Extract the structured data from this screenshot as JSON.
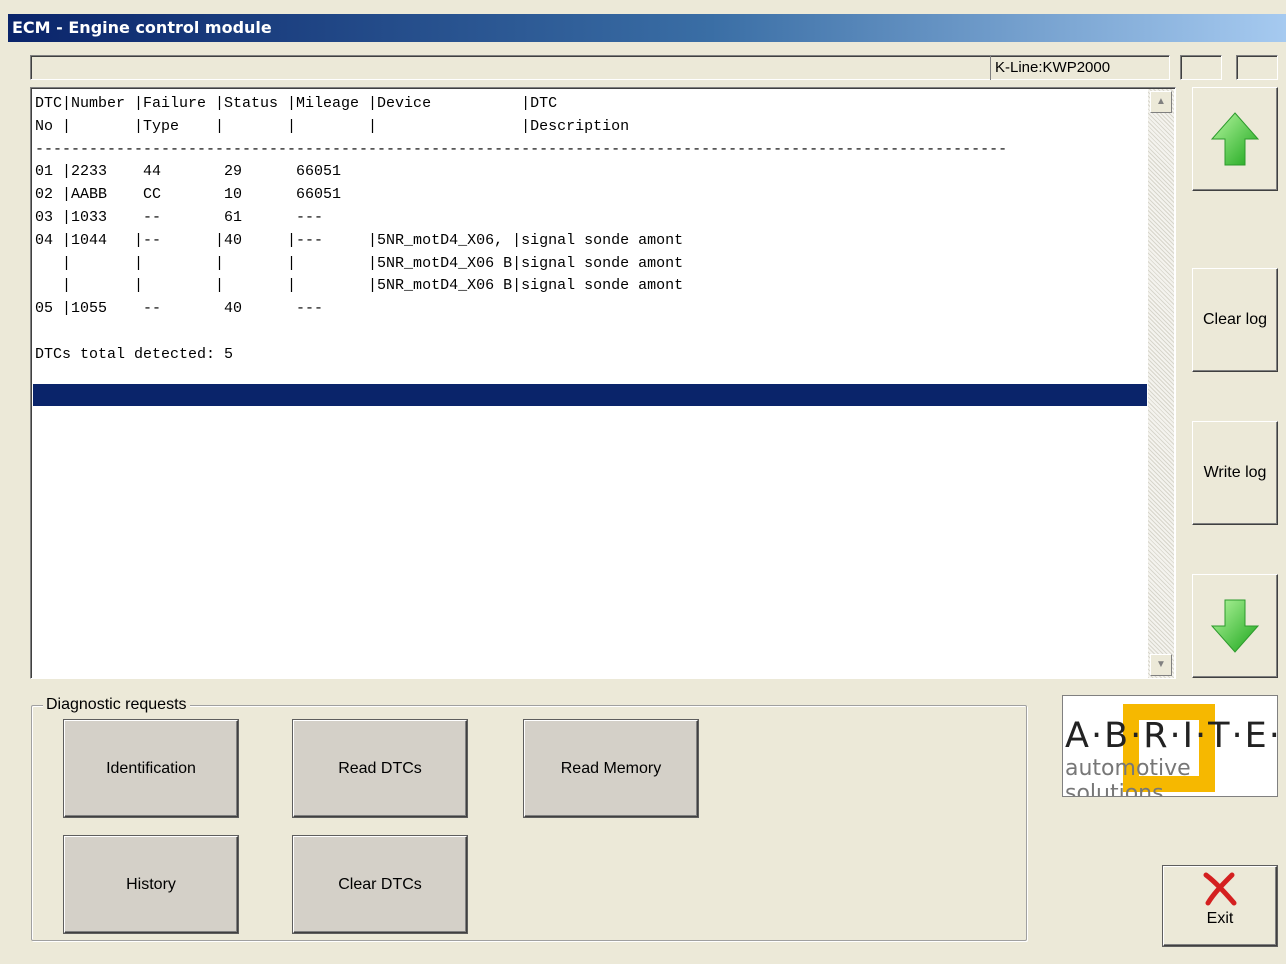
{
  "window": {
    "title": "ECM - Engine control module"
  },
  "status": {
    "protocol": "K-Line:KWP2000"
  },
  "log": {
    "lines": [
      "DTC|Number |Failure |Status |Mileage |Device          |DTC",
      "No |       |Type    |       |        |                |Description",
      "------------------------------------------------------------------------------------------------------------",
      "01 |2233    44       29      66051",
      "02 |AABB    CC       10      66051",
      "03 |1033    --       61      ---",
      "04 |1044   |--      |40     |---     |5NR_motD4_X06, |signal sonde amont",
      "   |       |        |       |        |5NR_motD4_X06 B|signal sonde amont",
      "   |       |        |       |        |5NR_motD4_X06 B|signal sonde amont",
      "05 |1055    --       40      ---",
      "",
      "DTCs total detected: 5"
    ]
  },
  "side_buttons": {
    "scroll_up_icon": "green-up-arrow-icon",
    "clear_log": "Clear log",
    "write_log": "Write log",
    "scroll_down_icon": "green-down-arrow-icon"
  },
  "diagnostic": {
    "group_label": "Diagnostic requests",
    "identification": "Identification",
    "read_dtcs": "Read DTCs",
    "read_memory": "Read Memory",
    "history": "History",
    "clear_dtcs": "Clear DTCs"
  },
  "logo": {
    "word": "A·B·R·I·T·E·S",
    "tagline": "automotive solutions",
    "accent_color": "#f6b800"
  },
  "exit": {
    "label": "Exit",
    "icon": "red-x-icon"
  }
}
